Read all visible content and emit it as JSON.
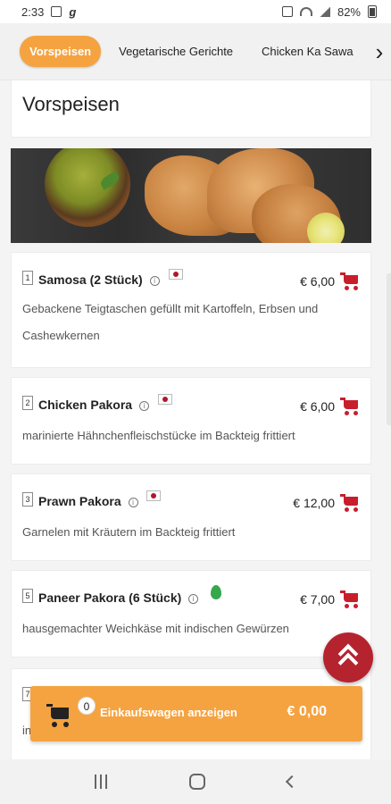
{
  "status": {
    "time": "2:33",
    "carrier_glyph": "g",
    "battery": "82%"
  },
  "tabs": [
    {
      "label": "Vorspeisen",
      "active": true
    },
    {
      "label": "Vegetarische Gerichte",
      "active": false
    },
    {
      "label": "Chicken Ka Sawa",
      "active": false
    }
  ],
  "section": {
    "title": "Vorspeisen"
  },
  "items": [
    {
      "number": "1",
      "name": "Samosa (2 Stück)",
      "price": "€ 6,00",
      "description": "Gebackene Teigtaschen gefüllt mit Kartoffeln, Erbsen und Cashewkernen",
      "badge": "flag"
    },
    {
      "number": "2",
      "name": "Chicken Pakora",
      "price": "€ 6,00",
      "description": "marinierte Hähnchenfleischstücke im Backteig frittiert",
      "badge": "flag"
    },
    {
      "number": "3",
      "name": "Prawn Pakora",
      "price": "€ 12,00",
      "description": "Garnelen mit Kräutern im Backteig frittiert",
      "badge": "flag"
    },
    {
      "number": "5",
      "name": "Paneer Pakora (6 Stück)",
      "price": "€ 7,00",
      "description": "hausgemachter Weichkäse mit indischen Gewürzen",
      "badge": "veg"
    },
    {
      "number": "7",
      "name": "",
      "price": "",
      "description": "in",
      "badge": ""
    }
  ],
  "cart": {
    "count": "0",
    "label": "Einkaufswagen anzeigen",
    "total": "€ 0,00"
  },
  "colors": {
    "accent": "#f5a340",
    "cart_red": "#c81e2c",
    "scroll_button": "#b5232f"
  }
}
